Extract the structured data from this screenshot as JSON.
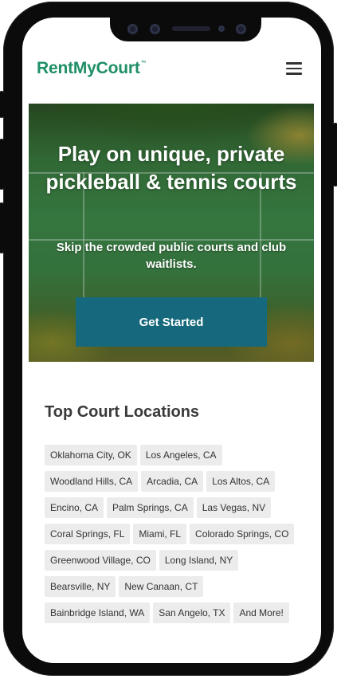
{
  "brand": {
    "name": "RentMyCourt",
    "tm": "™",
    "color": "#1f8f66"
  },
  "header": {
    "menu_icon": "hamburger-menu-icon"
  },
  "hero": {
    "title": "Play on unique, private pickleball & tennis courts",
    "subtitle": "Skip the crowded public courts and club waitlists.",
    "cta_label": "Get Started",
    "cta_color": "#16697d"
  },
  "locations": {
    "title": "Top Court Locations",
    "items": [
      "Oklahoma City, OK",
      "Los Angeles, CA",
      "Woodland Hills, CA",
      "Arcadia, CA",
      "Los Altos, CA",
      "Encino, CA",
      "Palm Springs, CA",
      "Las Vegas, NV",
      "Coral Springs, FL",
      "Miami, FL",
      "Colorado Springs, CO",
      "Greenwood Village, CO",
      "Long Island, NY",
      "Bearsville, NY",
      "New Canaan, CT",
      "Bainbridge Island, WA",
      "San Angelo, TX",
      "And More!"
    ]
  }
}
